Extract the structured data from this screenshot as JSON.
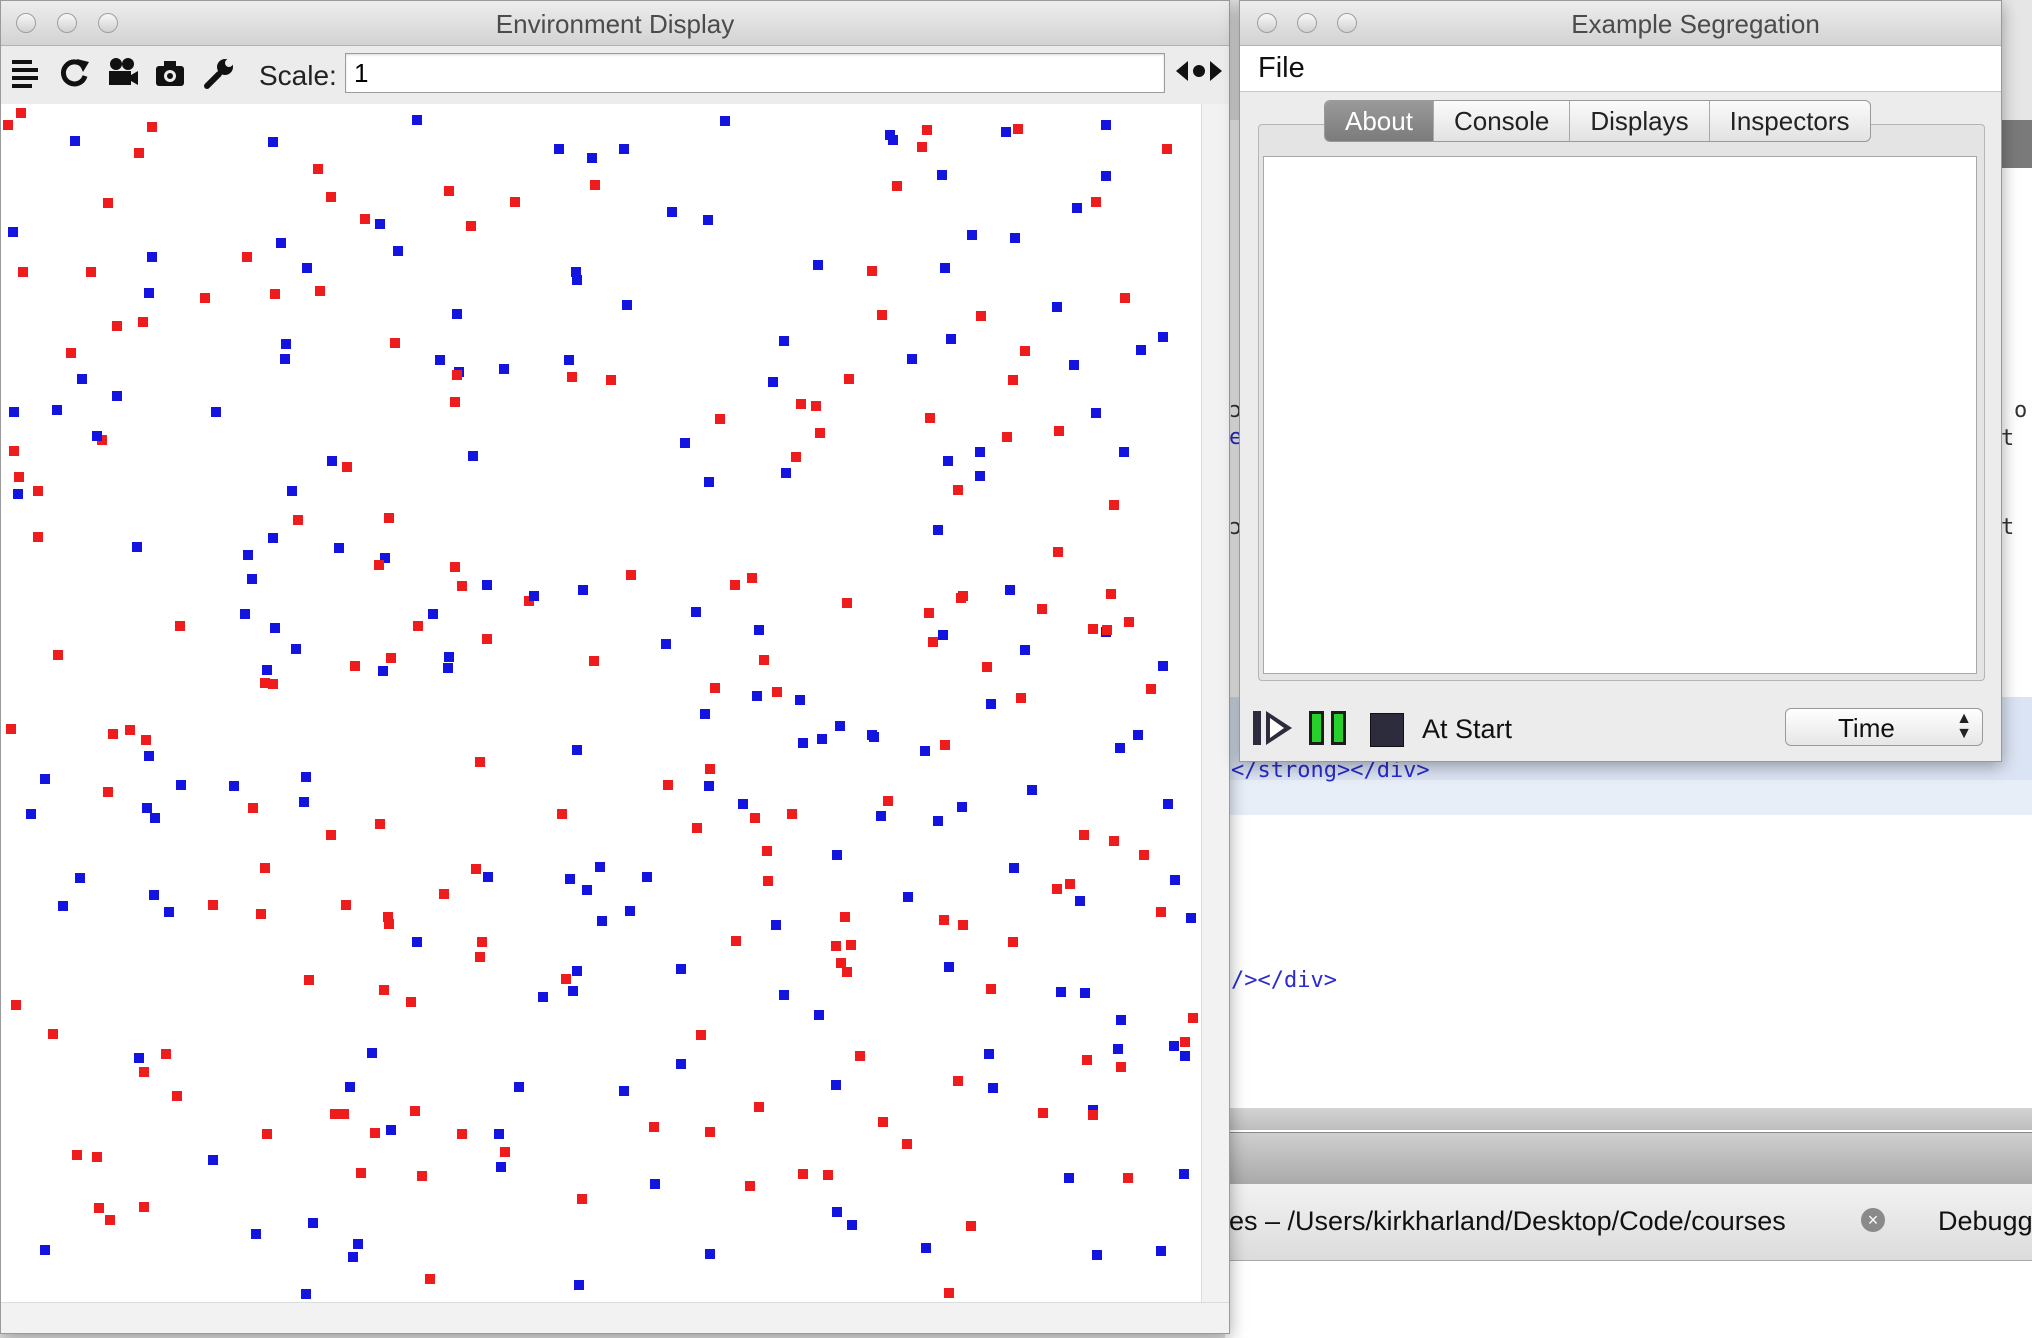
{
  "env_window": {
    "title": "Environment Display",
    "toolbar": {
      "icons": [
        "layers-icon",
        "refresh-icon",
        "movie-camera-icon",
        "camera-icon",
        "wrench-icon",
        "split-arrows-icon"
      ],
      "scale_label": "Scale:",
      "scale_value": "1"
    },
    "colors": {
      "red_agent": "#ee1c1c",
      "blue_agent": "#1414e0",
      "background": "#ffffff"
    }
  },
  "seg_window": {
    "title": "Example Segregation",
    "menu": {
      "file": "File"
    },
    "tabs": [
      {
        "label": "About",
        "active": true
      },
      {
        "label": "Console",
        "active": false
      },
      {
        "label": "Displays",
        "active": false
      },
      {
        "label": "Inspectors",
        "active": false
      }
    ],
    "controls": {
      "play_icon": "step-play-icon",
      "pause_icon": "pause-icon",
      "stop_icon": "stop-icon",
      "status": "At Start",
      "time_select": "Time"
    }
  },
  "background_app": {
    "code_lines": [
      "</strong></div>",
      "/></div>"
    ],
    "fragments": [
      "o",
      "t",
      "t",
      "ɔ",
      "e",
      "ɔ"
    ],
    "status_path": "es – /Users/kirkharland/Desktop/Code/courses",
    "status_tab": "Debugg"
  }
}
